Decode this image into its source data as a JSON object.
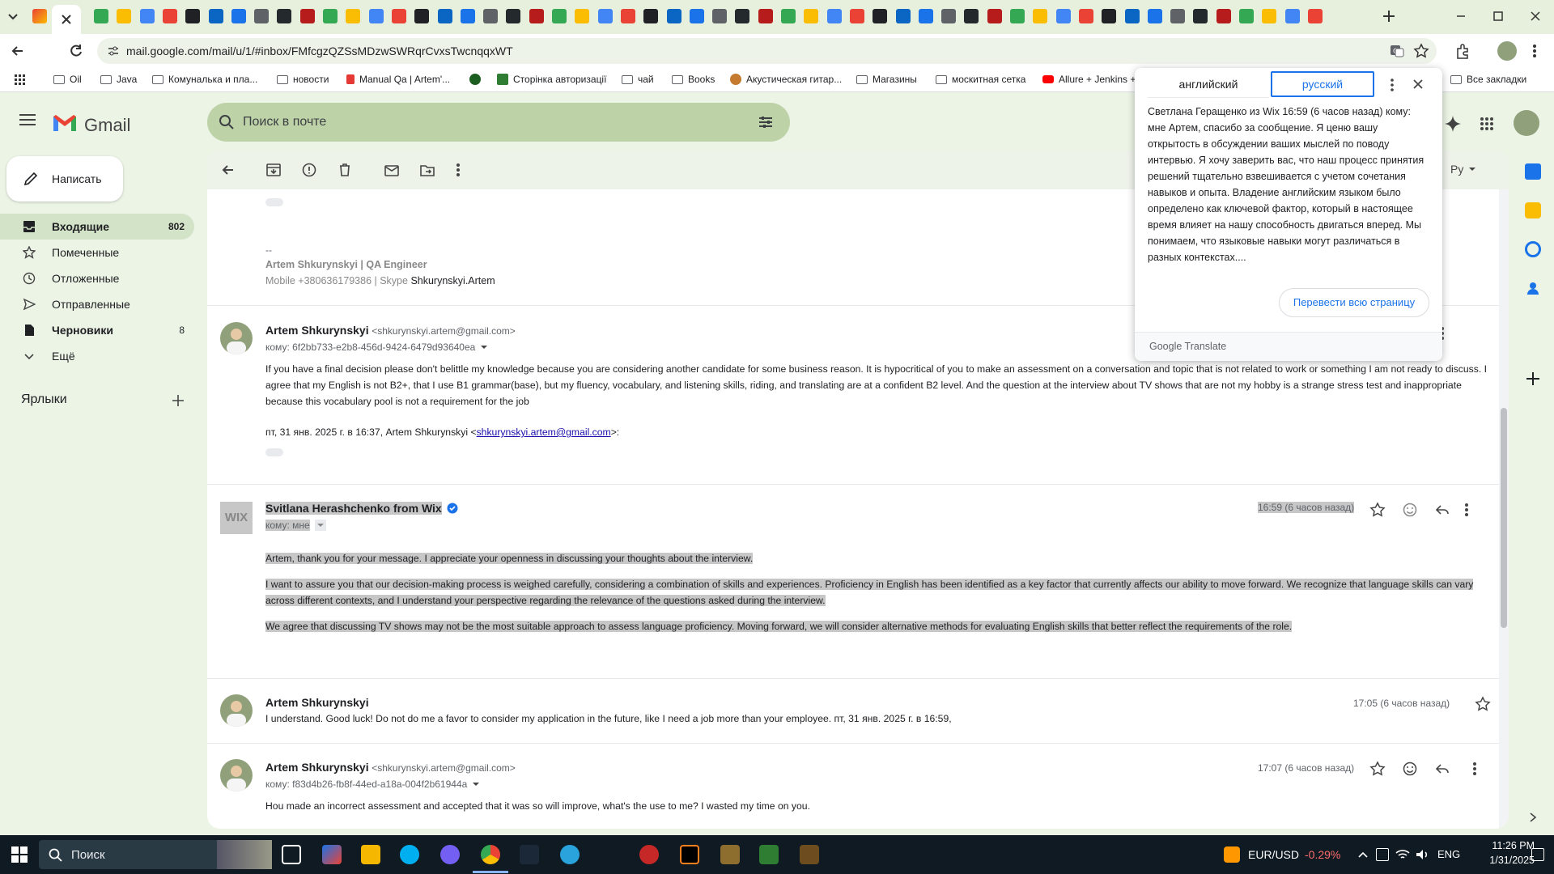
{
  "browser": {
    "url": "mail.google.com/mail/u/1/#inbox/FMfcgzQZSsMDzwSWRqrCvxsTwcnqqxWT",
    "bookmarks": [
      "Oil",
      "Java",
      "Комуналька и пла...",
      "новости",
      "Manual Qa | Artem'...",
      "",
      "Сторінка авторизації",
      "чай",
      "Books",
      "Акустическая гитар...",
      "Магазины",
      "москитная сетка",
      "Allure + Jenkins +"
    ],
    "all_bookmarks": "Все закладки"
  },
  "gmail": {
    "logo_text": "Gmail",
    "search_placeholder": "Поиск в почте",
    "compose_label": "Написать",
    "nav": [
      {
        "label": "Входящие",
        "count": "802",
        "icon": "inbox-icon"
      },
      {
        "label": "Помеченные",
        "count": "",
        "icon": "star-icon"
      },
      {
        "label": "Отложенные",
        "count": "",
        "icon": "clock-icon"
      },
      {
        "label": "Отправленные",
        "count": "",
        "icon": "send-icon"
      },
      {
        "label": "Черновики",
        "count": "8",
        "icon": "draft-icon"
      },
      {
        "label": "Ещё",
        "count": "",
        "icon": "chevron-down-icon"
      }
    ],
    "labels_title": "Ярлыки",
    "lang_indicator": "Ру"
  },
  "thread": {
    "top_signature": {
      "line_sep": "--",
      "name_title": "Artem Shkurynskyi | QA Engineer",
      "contact": "Mobile +380636179386 | Skype ",
      "skype": "Shkurynskyi.Artem"
    },
    "messages": [
      {
        "sender": "Artem Shkurynskyi",
        "email": "<shkurynskyi.artem@gmail.com>",
        "to": "кому: 6f2bb733-e2b8-456d-9424-6479d93640ea",
        "body": "If you have a final decision please don't belittle my knowledge because you are considering another candidate for some business reason. It is hypocritical of you to make an assessment on a conversation and topic that is not related to work or something I am not ready to discuss. I agree that my English is not B2+, that I use B1 grammar(base), but my fluency, vocabulary, and listening skills, riding, and translating are at a confident B2 level. And the question at the interview about TV shows that are not my hobby is a strange stress test and inappropriate because this vocabulary pool is not a requirement for the job",
        "quote_prefix": "пт, 31 янв. 2025 г. в 16:37, Artem Shkurynskyi <",
        "quote_link": "shkurynskyi.artem@gmail.com",
        "quote_suffix": ">:"
      },
      {
        "sender": "Svitlana Herashchenko from Wix",
        "avatar_text": "WIX",
        "to": "кому: мне",
        "time": "16:59 (6 часов назад)",
        "p1": "Artem, thank you for your message. I appreciate your openness in discussing your thoughts about the interview.",
        "p2": "I want to assure you that our decision-making process is weighed carefully, considering a combination of skills and experiences. Proficiency in English has been identified as a key factor that currently affects our ability to move forward. We recognize that language skills can vary across different contexts, and I understand your perspective regarding the relevance of the questions asked during the interview.",
        "p3": "We agree that discussing TV shows may not be the most suitable approach to assess language proficiency. Moving forward, we will consider alternative methods for evaluating English skills that better reflect the requirements of the role."
      },
      {
        "sender": "Artem Shkurynskyi",
        "time": "17:05 (6 часов назад)",
        "snippet": "I understand. Good luck! Do not do me a favor to consider my application in the future, like I need a job more than your employee. пт, 31 янв. 2025 г. в 16:59,"
      },
      {
        "sender": "Artem Shkurynskyi",
        "email": "<shkurynskyi.artem@gmail.com>",
        "to": "кому: f83d4b26-fb8f-44ed-a18a-004f2b61944a",
        "time": "17:07 (6 часов назад)",
        "body": "Hou made an incorrect assessment and accepted that it was so will improve, what's the use to me? I wasted my time on you."
      }
    ]
  },
  "translate_popup": {
    "source_lang": "английский",
    "target_lang": "русский",
    "text": "Светлана Геращенко из Wix 16:59 (6 часов назад) кому: мне Артем, спасибо за сообщение. Я ценю вашу открытость в обсуждении ваших мыслей по поводу интервью. Я хочу заверить вас, что наш процесс принятия решений тщательно взвешивается с учетом сочетания навыков и опыта. Владение английским языком было определено как ключевой фактор, который в настоящее время влияет на нашу способность двигаться вперед. Мы понимаем, что языковые навыки могут различаться в разных контекстах....",
    "translate_page_btn": "Перевести всю страницу",
    "footer": "Google Translate"
  },
  "taskbar": {
    "search_label": "Поиск",
    "ticker_pair": "EUR/USD",
    "ticker_change": "-0.29%",
    "lang": "ENG",
    "time": "11:26 PM",
    "date": "1/31/2025"
  },
  "colors": {
    "accent_blue": "#1a73e8",
    "ticker_red": "#ff6b6b",
    "gmail_bg": "#ecf4e6"
  }
}
